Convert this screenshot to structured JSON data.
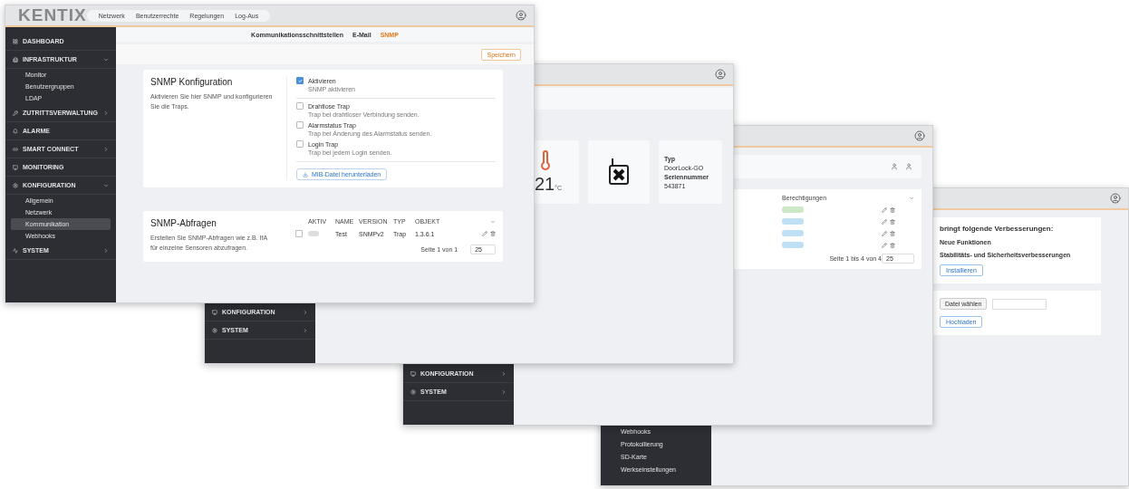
{
  "windows": [
    {
      "kind": "snmp",
      "logo": "KENTIX",
      "nav": [
        "Netzwerk",
        "Benutzerrechte",
        "Regelungen",
        "Log-Aus"
      ],
      "sidebar": [
        {
          "label": "DASHBOARD"
        },
        {
          "label": "INFRASTRUKTUR",
          "expanded": true,
          "children": [
            {
              "label": "Monitor",
              "selected": false
            },
            {
              "label": "Benutzergruppen",
              "selected": false
            },
            {
              "label": "LDAP",
              "selected": false
            }
          ]
        },
        {
          "label": "ZUTRITTSVERWALTUNG",
          "expanded": false
        },
        {
          "label": "ALARME"
        },
        {
          "label": "SMART CONNECT",
          "expanded": false
        },
        {
          "label": "MONITORING"
        },
        {
          "label": "KONFIGURATION",
          "expanded": true,
          "children": [
            {
              "label": "Allgemein",
              "selected": false
            },
            {
              "label": "Netzwerk",
              "selected": false
            },
            {
              "label": "Kommunikation",
              "selected": true
            },
            {
              "label": "Webhooks",
              "selected": false
            }
          ]
        },
        {
          "label": "SYSTEM",
          "expanded": false
        }
      ],
      "subtabs": [
        {
          "label": "Kommunikationsschnittstellen",
          "selected": false
        },
        {
          "label": "E-Mail",
          "selected": false
        },
        {
          "label": "SNMP",
          "selected": true
        }
      ],
      "save_button": "Speichern",
      "config": {
        "title": "SNMP Konfiguration",
        "description": "Aktivieren Sie hier SNMP und konfigurieren Sie die Traps.",
        "button": "MIB-Datei herunterladen",
        "options": [
          {
            "label": "Aktivieren",
            "hint": "SNMP aktivieren",
            "checked": true
          },
          {
            "label": "Drahtlose Trap",
            "hint": "Trap bei drahtloser Verbindung senden.",
            "checked": false
          },
          {
            "label": "Alarmstatus Trap",
            "hint": "Trap bei Änderung des Alarmstatus senden.",
            "checked": false
          },
          {
            "label": "Login Trap",
            "hint": "Trap bei jedem Login senden.",
            "checked": false
          }
        ]
      },
      "queries": {
        "title": "SNMP-Abfragen",
        "description": "Erstellen Sie SNMP-Abfragen wie z.B. IfA für einzelne Sensoren abzufragen.",
        "columns": [
          "AKTIV",
          "NAME",
          "VERSION",
          "TYP",
          "OBJEKT"
        ],
        "rows": [
          {
            "selected": false,
            "active": false,
            "cells": [
              "",
              "Test",
              "SNMPv2",
              "Trap",
              "1.3.6.1"
            ]
          }
        ],
        "pagination": "Seite 1 von 1",
        "page_size": "25"
      }
    },
    {
      "kind": "device",
      "sidebar": [
        {
          "label": "KONFIGURATION",
          "expanded": false
        },
        {
          "label": "SYSTEM",
          "expanded": false
        }
      ],
      "temperature": {
        "value": "21",
        "unit": "°C"
      },
      "info": [
        {
          "label": "Typ",
          "value": "DoorLock-GO"
        },
        {
          "label": "Seriennummer",
          "value": "543871"
        }
      ]
    },
    {
      "kind": "users",
      "sidebar": [
        {
          "label": "KONFIGURATION",
          "expanded": false
        },
        {
          "label": "SYSTEM",
          "expanded": false
        }
      ],
      "column": "Berechtigungen",
      "rows": [
        {
          "color": "#cde8c6"
        },
        {
          "color": "#bfe0f5"
        },
        {
          "color": "#bfe0f5"
        },
        {
          "color": "#bfe0f5"
        }
      ],
      "pagination": "Seite 1 bis 4 von 4",
      "page_size": "25"
    },
    {
      "kind": "update",
      "sidebar": [
        {
          "label": "Webhooks"
        },
        {
          "label": "Protokollierung"
        },
        {
          "label": "SD-Karte"
        },
        {
          "label": "Werkseinstellungen"
        }
      ],
      "heading": "bringt folgende Verbesserungen:",
      "items": [
        "Neue Funktionen",
        "Stabilitäts- und Sicherheitsverbesserungen"
      ],
      "install_button": "Installieren",
      "file_button": "Datei wählen",
      "upload_button": "Hochladen"
    }
  ]
}
